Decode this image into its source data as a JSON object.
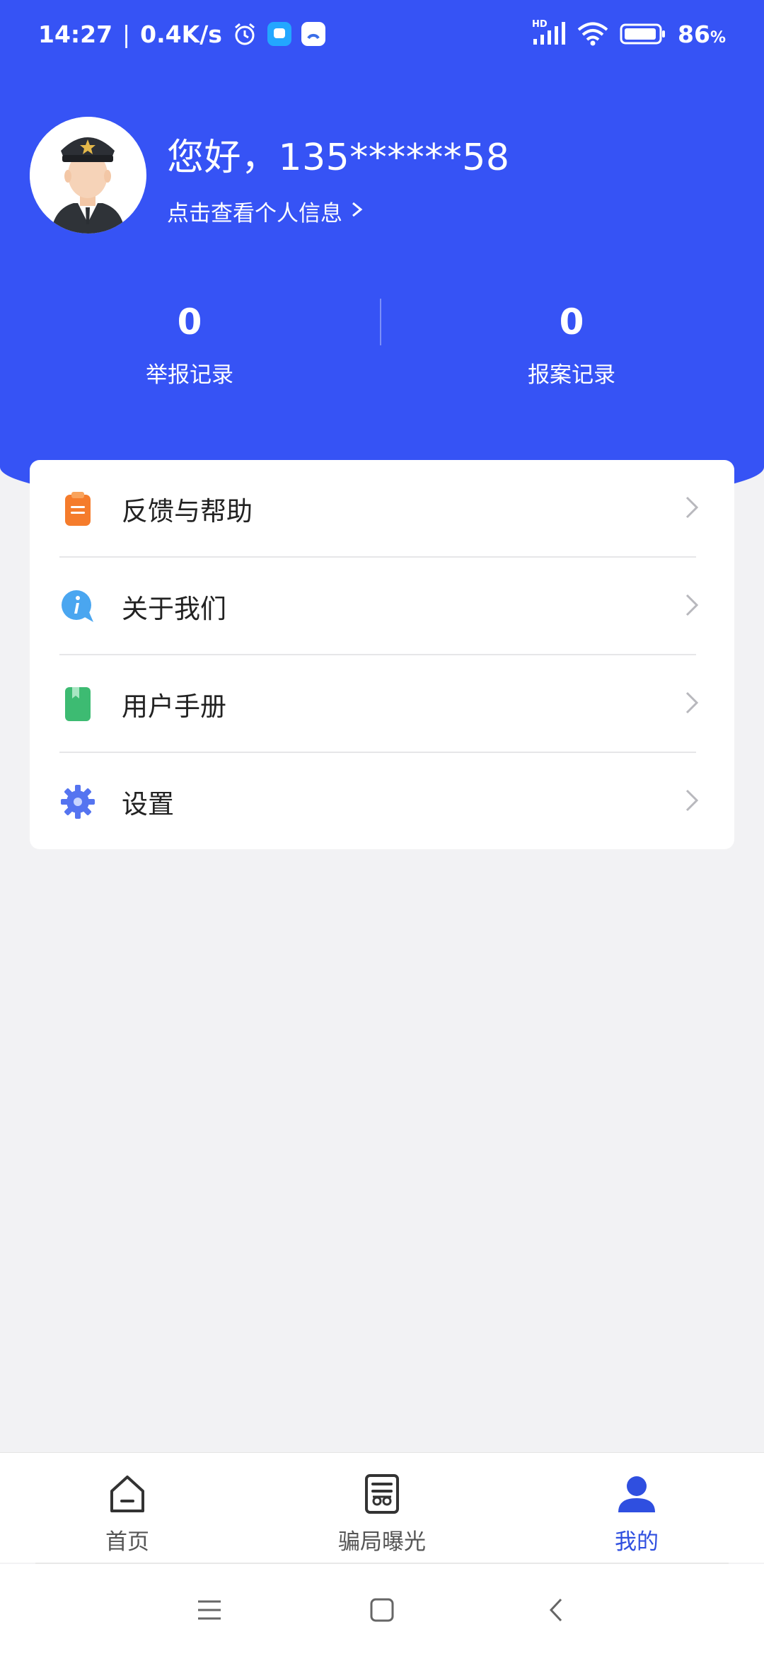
{
  "status_bar": {
    "time": "14:27",
    "speed": "0.4K/s",
    "network": "HD",
    "battery": "86",
    "battery_unit": "%"
  },
  "profile": {
    "greeting": "您好，135******58",
    "link_label": "点击查看个人信息"
  },
  "stats": [
    {
      "value": "0",
      "label": "举报记录"
    },
    {
      "value": "0",
      "label": "报案记录"
    }
  ],
  "menu": {
    "items": [
      {
        "label": "反馈与帮助",
        "icon": "feedback-clipboard-icon",
        "color": "#f57c2c"
      },
      {
        "label": "关于我们",
        "icon": "info-bubble-icon",
        "color": "#4aa6f0"
      },
      {
        "label": "用户手册",
        "icon": "manual-book-icon",
        "color": "#3dbb72"
      },
      {
        "label": "设置",
        "icon": "gear-icon",
        "color": "#5574f0"
      }
    ]
  },
  "bottom_nav": {
    "items": [
      {
        "label": "首页",
        "icon": "home-icon"
      },
      {
        "label": "骗局曝光",
        "icon": "exposure-document-icon"
      },
      {
        "label": "我的",
        "icon": "user-icon"
      }
    ],
    "active": "我的"
  },
  "colors": {
    "header_blue": "#3653f5",
    "active_nav": "#2f4fe0"
  }
}
